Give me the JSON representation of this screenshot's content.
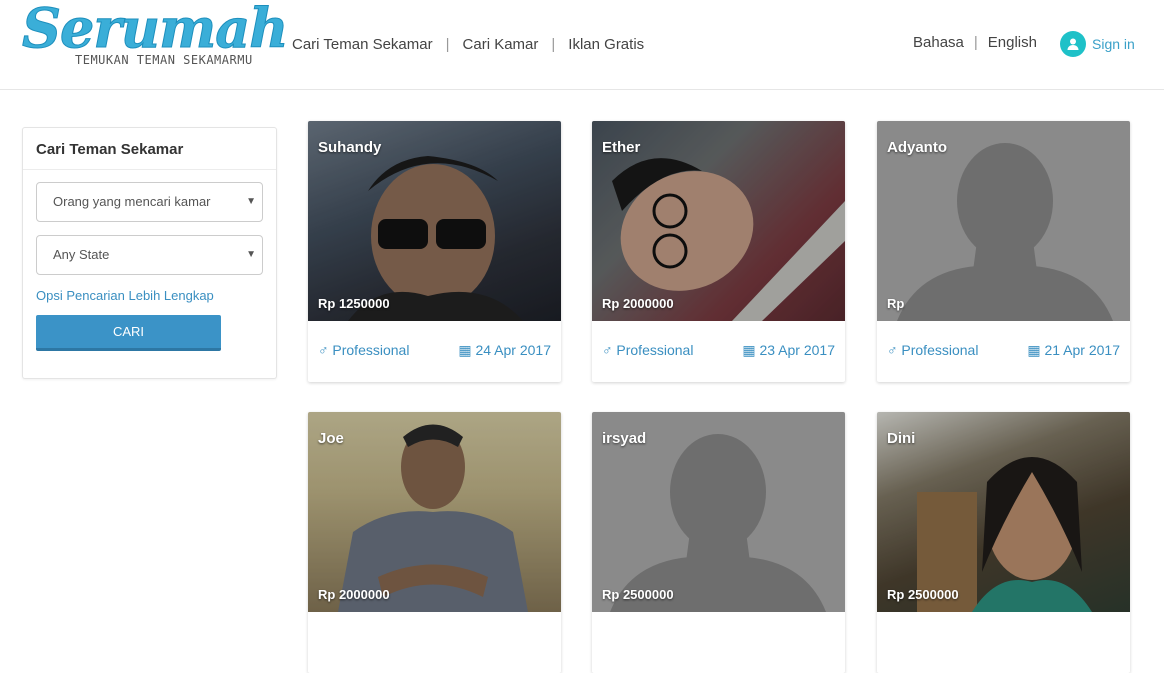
{
  "brand": {
    "name": "Serumah",
    "tagline": "TEMUKAN TEMAN SEKAMARMU"
  },
  "nav": {
    "items": [
      {
        "label": "Cari Teman Sekamar"
      },
      {
        "label": "Cari Kamar"
      },
      {
        "label": "Iklan Gratis"
      }
    ]
  },
  "lang": {
    "bahasa": "Bahasa",
    "english": "English"
  },
  "signin": {
    "label": "Sign in"
  },
  "sidebar": {
    "title": "Cari Teman Sekamar",
    "type_select": "Orang yang mencari kamar",
    "state_select": "Any State",
    "more_link": "Opsi Pencarian Lebih Lengkap",
    "search_button": "CARI"
  },
  "listings": [
    {
      "name": "Suhandy",
      "price": "Rp 1250000",
      "occupation": "Professional",
      "date": "24 Apr 2017",
      "photo": "photo"
    },
    {
      "name": "Ether",
      "price": "Rp 2000000",
      "occupation": "Professional",
      "date": "23 Apr 2017",
      "photo": "photo"
    },
    {
      "name": "Adyanto",
      "price": "Rp",
      "occupation": "Professional",
      "date": "21 Apr 2017",
      "photo": "placeholder"
    },
    {
      "name": "Joe",
      "price": "Rp 2000000",
      "photo": "photo"
    },
    {
      "name": "irsyad",
      "price": "Rp 2500000",
      "photo": "placeholder"
    },
    {
      "name": "Dini",
      "price": "Rp 2500000",
      "photo": "photo"
    }
  ],
  "colors": {
    "accent": "#3aaed8",
    "link": "#3a8fc1",
    "button": "#3b93c7",
    "signin_icon": "#1ec1c8"
  },
  "icons": {
    "gender": "male-icon",
    "date": "calendar-icon",
    "user": "user-icon",
    "dropdown": "caret-down-icon"
  }
}
